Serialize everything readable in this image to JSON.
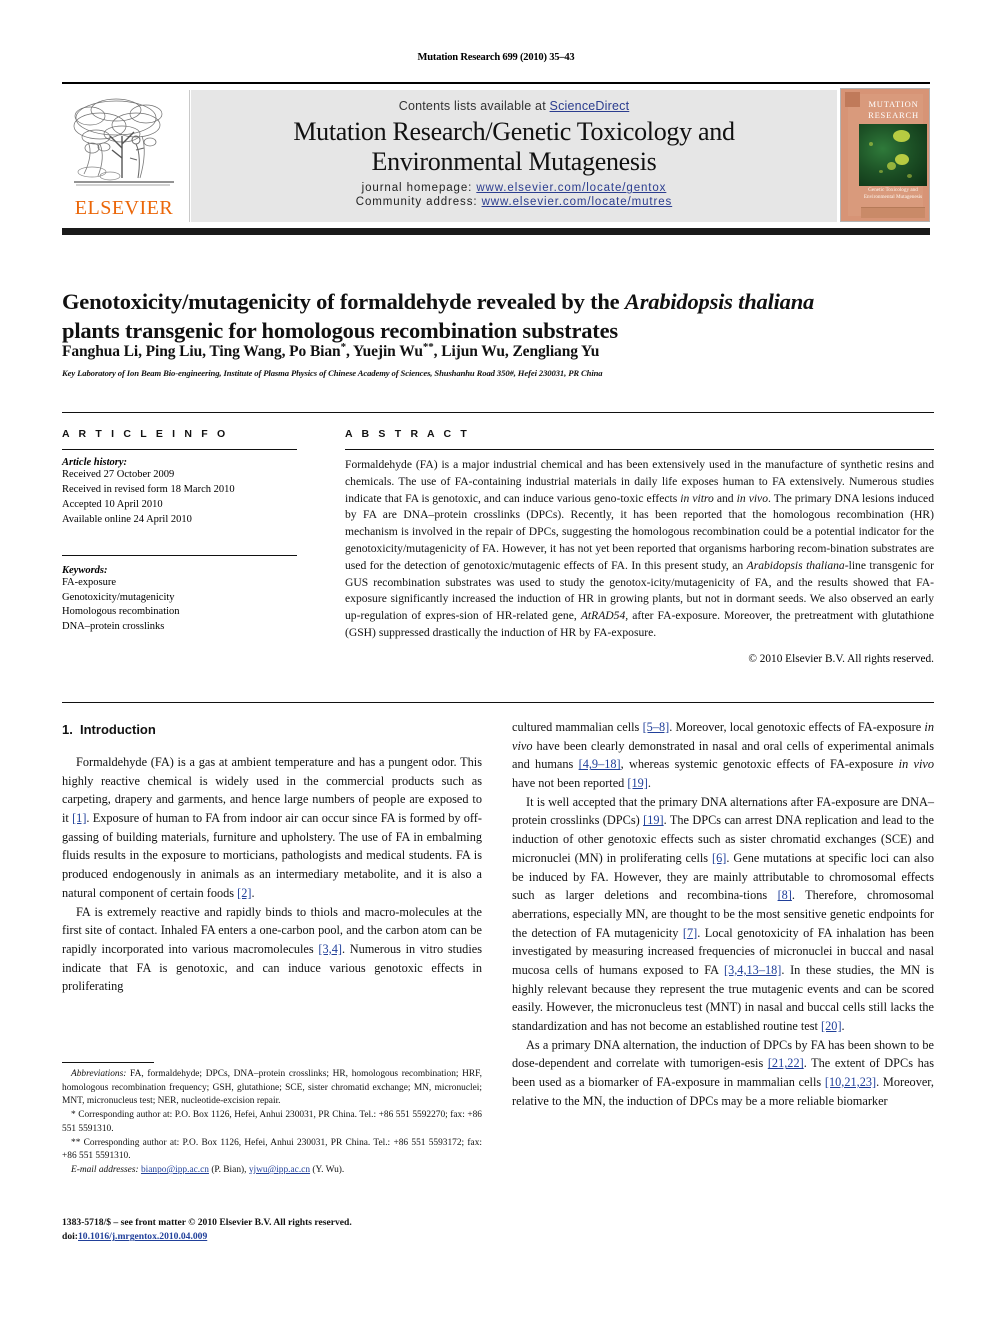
{
  "running_head": "Mutation Research 699 (2010) 35–43",
  "header": {
    "contents_prefix": "Contents lists available at ",
    "sciencedirect": "ScienceDirect",
    "journal_title_line1": "Mutation Research/Genetic Toxicology and",
    "journal_title_line2": "Environmental Mutagenesis",
    "homepage_label": "journal homepage:",
    "homepage_url": "www.elsevier.com/locate/gentox",
    "community_label": "Community address:",
    "community_url": "www.elsevier.com/locate/mutres",
    "publisher": "ELSEVIER",
    "cover": {
      "title_line1": "MUTATION",
      "title_line2": "RESEARCH",
      "subtitle_line1": "Genetic Toxicology and",
      "subtitle_line2": "Environmental Mutagenesis",
      "footer": "Genetic Toxicology and Environmental Mutagenesis",
      "background_color": "#d79476",
      "image_color": "#1d5226"
    }
  },
  "article": {
    "title_part1": "Genotoxicity/mutagenicity of formaldehyde revealed by the ",
    "title_italic": "Arabidopsis thaliana",
    "title_part2": "plants transgenic for homologous recombination substrates",
    "authors": "Fanghua Li, Ping Liu, Ting Wang, Po Bian",
    "authors_mid": ", Yuejin Wu",
    "authors_end": ", Lijun Wu, Zengliang Yu",
    "star1": "*",
    "star2": "**",
    "affiliation": "Key Laboratory of Ion Beam Bio-engineering, Institute of Plasma Physics of Chinese Academy of Sciences, Shushanhu Road 350#, Hefei 230031, PR China"
  },
  "article_info": {
    "heading": "A R T I C L E   I N F O",
    "history_label": "Article history:",
    "history": [
      "Received 27 October 2009",
      "Received in revised form 18 March 2010",
      "Accepted 10 April 2010",
      "Available online 24 April 2010"
    ],
    "keywords_label": "Keywords:",
    "keywords": [
      "FA-exposure",
      "Genotoxicity/mutagenicity",
      "Homologous recombination",
      "DNA–protein crosslinks"
    ]
  },
  "abstract": {
    "heading": "A B S T R A C T",
    "text_1": "Formaldehyde (FA) is a major industrial chemical and has been extensively used in the manufacture of synthetic resins and chemicals. The use of FA-containing industrial materials in daily life exposes human to FA extensively. Numerous studies indicate that FA is genotoxic, and can induce various geno-toxic effects ",
    "italic_1": "in vitro",
    "text_2": " and ",
    "italic_2": "in vivo",
    "text_3": ". The primary DNA lesions induced by FA are DNA–protein crosslinks (DPCs). Recently, it has been reported that the homologous recombination (HR) mechanism is involved in the repair of DPCs, suggesting the homologous recombination could be a potential indicator for the genotoxicity/mutagenicity of FA. However, it has not yet been reported that organisms harboring recom-bination substrates are used for the detection of genotoxic/mutagenic effects of FA. In this present study, an ",
    "italic_3": "Arabidopsis thaliana",
    "text_4": "-line transgenic for GUS recombination substrates was used to study the genotox-icity/mutagenicity of FA, and the results showed that FA-exposure significantly increased the induction of HR in growing plants, but not in dormant seeds. We also observed an early up-regulation of expres-sion of HR-related gene, ",
    "italic_4": "AtRAD54",
    "text_5": ", after FA-exposure. Moreover, the pretreatment with glutathione (GSH) suppressed drastically the induction of HR by FA-exposure.",
    "copyright": "© 2010 Elsevier B.V. All rights reserved."
  },
  "introduction": {
    "heading_num": "1.",
    "heading_text": "Introduction",
    "left_p1_a": "Formaldehyde (FA) is a gas at ambient temperature and has a pungent odor. This highly reactive chemical is widely used in the commercial products such as carpeting, drapery and garments, and hence large numbers of people are exposed to it ",
    "left_p1_ref1": "[1]",
    "left_p1_b": ". Exposure of human to FA from indoor air can occur since FA is formed by off-gassing of building materials, furniture and upholstery. The use of FA in embalming fluids results in the exposure to morticians, pathologists and medical students. FA is produced endogenously in animals as an intermediary metabolite, and it is also a natural component of certain foods ",
    "left_p1_ref2": "[2]",
    "left_p1_c": ".",
    "left_p2_a": "FA is extremely reactive and rapidly binds to thiols and macro-molecules at the first site of contact. Inhaled FA enters a one-carbon pool, and the carbon atom can be rapidly incorporated into various macromolecules ",
    "left_p2_ref1": "[3,4]",
    "left_p2_b": ". Numerous in vitro studies indicate that FA is genotoxic, and can induce various genotoxic effects in proliferating",
    "right_p1_a": "cultured mammalian cells ",
    "right_p1_ref1": "[5–8]",
    "right_p1_b": ". Moreover, local genotoxic effects of FA-exposure ",
    "right_p1_it1": "in vivo",
    "right_p1_c": " have been clearly demonstrated in nasal and oral cells of experimental animals and humans ",
    "right_p1_ref2": "[4,9–18]",
    "right_p1_d": ", whereas systemic genotoxic effects of FA-exposure ",
    "right_p1_it2": "in vivo",
    "right_p1_e": " have not been reported ",
    "right_p1_ref3": "[19]",
    "right_p1_f": ".",
    "right_p2_a": "It is well accepted that the primary DNA alternations after FA-exposure are DNA–protein crosslinks (DPCs) ",
    "right_p2_ref1": "[19]",
    "right_p2_b": ". The DPCs can arrest DNA replication and lead to the induction of other genotoxic effects such as sister chromatid exchanges (SCE) and micronuclei (MN) in proliferating cells ",
    "right_p2_ref2": "[6]",
    "right_p2_c": ". Gene mutations at specific loci can also be induced by FA. However, they are mainly attributable to chromosomal effects such as larger deletions and recombina-tions ",
    "right_p2_ref3": "[8]",
    "right_p2_d": ". Therefore, chromosomal aberrations, especially MN, are thought to be the most sensitive genetic endpoints for the detection of FA mutagenicity ",
    "right_p2_ref4": "[7]",
    "right_p2_e": ". Local genotoxicity of FA inhalation has been investigated by measuring increased frequencies of micronuclei in buccal and nasal mucosa cells of humans exposed to FA ",
    "right_p2_ref5": "[3,4,13–18]",
    "right_p2_f": ". In these studies, the MN is highly relevant because they represent the true mutagenic events and can be scored easily. However, the micronucleus test (MNT) in nasal and buccal cells still lacks the standardization and has not become an established routine test ",
    "right_p2_ref6": "[20]",
    "right_p2_g": ".",
    "right_p3_a": "As a primary DNA alternation, the induction of DPCs by FA has been shown to be dose-dependent and correlate with tumorigen-esis ",
    "right_p3_ref1": "[21,22]",
    "right_p3_b": ". The extent of DPCs has been used as a biomarker of FA-exposure in mammalian cells ",
    "right_p3_ref2": "[10,21,23]",
    "right_p3_c": ". Moreover, relative to the MN, the induction of DPCs may be a more reliable biomarker"
  },
  "footnotes": {
    "abbrev_label": "Abbreviations:",
    "abbrev_text": " FA, formaldehyde; DPCs, DNA–protein crosslinks; HR, homologous recombination; HRF, homologous recombination frequency; GSH, glutathione; SCE, sister chromatid exchange; MN, micronuclei; MNT, micronucleus test; NER, nucleotide-excision repair.",
    "corr1": "* Corresponding author at: P.O. Box 1126, Hefei, Anhui 230031, PR China. Tel.: +86 551 5592270; fax: +86 551 5591310.",
    "corr2": "** Corresponding author at: P.O. Box 1126, Hefei, Anhui 230031, PR China. Tel.: +86 551 5593172; fax: +86 551 5591310.",
    "email_label": "E-mail addresses:",
    "email1": "bianpo@ipp.ac.cn",
    "email1_owner": " (P. Bian), ",
    "email2": "yjwu@ipp.ac.cn",
    "email2_owner": " (Y. Wu)."
  },
  "imprint": {
    "line1": "1383-5718/$ – see front matter © 2010 Elsevier B.V. All rights reserved.",
    "doi_label": "doi:",
    "doi_value": "10.1016/j.mrgentox.2010.04.009"
  },
  "colors": {
    "link": "#21409a",
    "elsevier_orange": "#eb6608",
    "header_band": "#e6e6e6"
  }
}
